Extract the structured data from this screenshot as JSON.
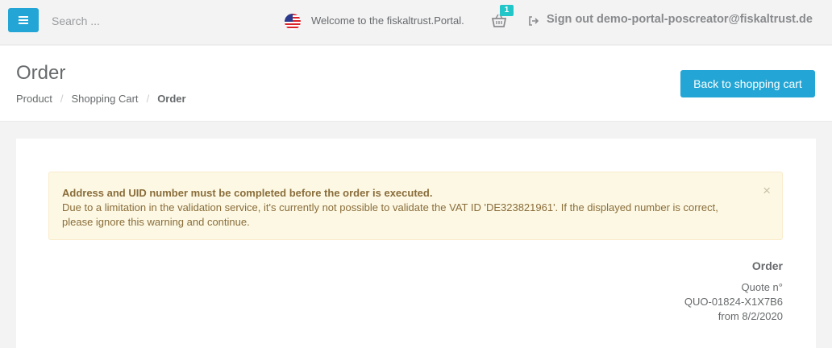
{
  "header": {
    "search_placeholder": "Search ...",
    "welcome_text": "Welcome to the fiskaltrust.Portal.",
    "cart_count": "1",
    "signout_text": "Sign out demo-portal-poscreator@fiskaltrust.de",
    "icons": [
      "menu-icon",
      "us-flag-icon",
      "shopping-basket-icon",
      "sign-out-icon"
    ]
  },
  "page": {
    "title": "Order",
    "breadcrumb": [
      "Product",
      "Shopping Cart",
      "Order"
    ],
    "back_button": "Back to shopping cart"
  },
  "alert": {
    "title": "Address and UID number must be completed before the order is executed.",
    "text": "Due to a limitation in the validation service, it's currently not possible to validate the VAT ID 'DE323821961'. If the displayed number is correct, please ignore this warning and continue.",
    "close": "×"
  },
  "order": {
    "heading": "Order",
    "quote_label": "Quote n°",
    "quote_number": "QUO-01824-X1X7B6",
    "date": "from 8/2/2020"
  },
  "colors": {
    "primary": "#23a6d5",
    "badge": "#23c6c8",
    "alert_bg": "#fcf8e3",
    "alert_text": "#8a6d3b"
  }
}
